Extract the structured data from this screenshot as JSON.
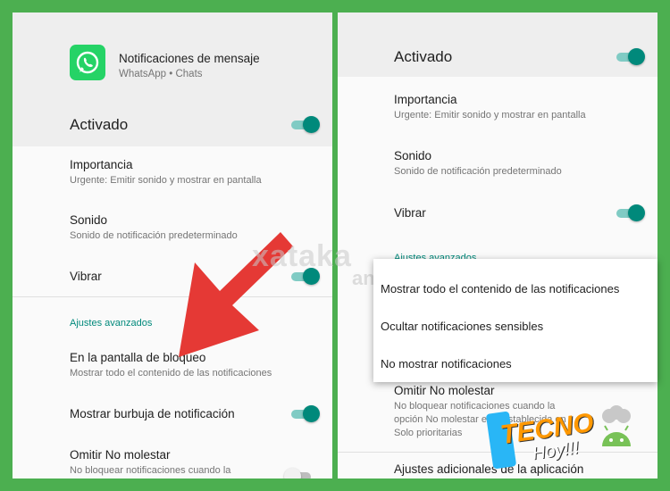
{
  "left": {
    "app_title": "Notificaciones de mensaje",
    "app_subtitle": "WhatsApp • Chats",
    "active_label": "Activado",
    "importance_title": "Importancia",
    "importance_sub": "Urgente: Emitir sonido y mostrar en pantalla",
    "sound_title": "Sonido",
    "sound_sub": "Sonido de notificación predeterminado",
    "vibrate_title": "Vibrar",
    "advanced_title": "Ajustes avanzados",
    "lockscreen_title": "En la pantalla de bloqueo",
    "lockscreen_sub": "Mostrar todo el contenido de las notificaciones",
    "bubble_title": "Mostrar burbuja de notificación",
    "dnd_title": "Omitir No molestar",
    "dnd_sub": "No bloquear notificaciones cuando la"
  },
  "right": {
    "active_label": "Activado",
    "importance_title": "Importancia",
    "importance_sub": "Urgente: Emitir sonido y mostrar en pantalla",
    "sound_title": "Sonido",
    "sound_sub": "Sonido de notificación predeterminado",
    "vibrate_title": "Vibrar",
    "advanced_title": "Ajustes avanzados",
    "dnd_title": "Omitir No molestar",
    "dnd_sub_1": "No bloquear notificaciones cuando la",
    "dnd_sub_2": "opción No molestar esté establecida en",
    "dnd_sub_3": "Solo prioritarias",
    "extra_settings": "Ajustes adicionales de la aplicación"
  },
  "popup": {
    "options": [
      "Mostrar todo el contenido de las notificaciones",
      "Ocultar notificaciones sensibles",
      "No mostrar notificaciones"
    ]
  },
  "watermark": {
    "brand": "xataka",
    "sub": "android"
  },
  "badge": {
    "line1": "TECNO",
    "line2": "Hoy!!!"
  },
  "colors": {
    "border": "#4caf50",
    "accent": "#00897b",
    "arrow": "#e53935",
    "whatsapp": "#25d366"
  }
}
